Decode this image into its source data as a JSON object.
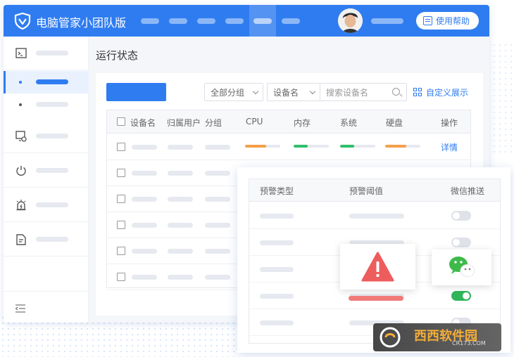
{
  "app": {
    "title": "电脑管家小团队版",
    "help_label": "使用帮助",
    "accent_color": "#2f7cf0"
  },
  "page": {
    "title": "运行状态"
  },
  "toolbar": {
    "group_select": "全部分组",
    "device_select": "设备名",
    "search_placeholder": "搜索设备名",
    "custom_display": "自定义展示"
  },
  "table": {
    "columns": [
      "设备名",
      "归属用户",
      "分组",
      "CPU",
      "内存",
      "系统",
      "硬盘",
      "操作"
    ],
    "first_row_action": "详情",
    "first_row_bars": [
      {
        "name": "CPU",
        "fill": 0.6,
        "color": "#f5a04a"
      },
      {
        "name": "内存",
        "fill": 0.4,
        "color": "#2fbf6a"
      },
      {
        "name": "系统",
        "fill": 0.4,
        "color": "#2fbf6a"
      },
      {
        "name": "硬盘",
        "fill": 0.6,
        "color": "#f5a04a"
      }
    ]
  },
  "alert_panel": {
    "columns": [
      "预警类型",
      "预警阈值",
      "微信推送"
    ],
    "toggles": [
      false,
      false,
      false,
      true,
      false
    ]
  },
  "icons": {
    "logo": "shield-v-icon",
    "sidebar": [
      "terminal-icon",
      "monitor-settings-icon",
      "power-icon",
      "alarm-lamp-icon",
      "document-icon",
      "collapse-icon"
    ],
    "warning": "warning-triangle-icon",
    "wechat": "wechat-icon"
  },
  "watermark": {
    "text": "西西软件园",
    "sub": "CR173.COM"
  }
}
